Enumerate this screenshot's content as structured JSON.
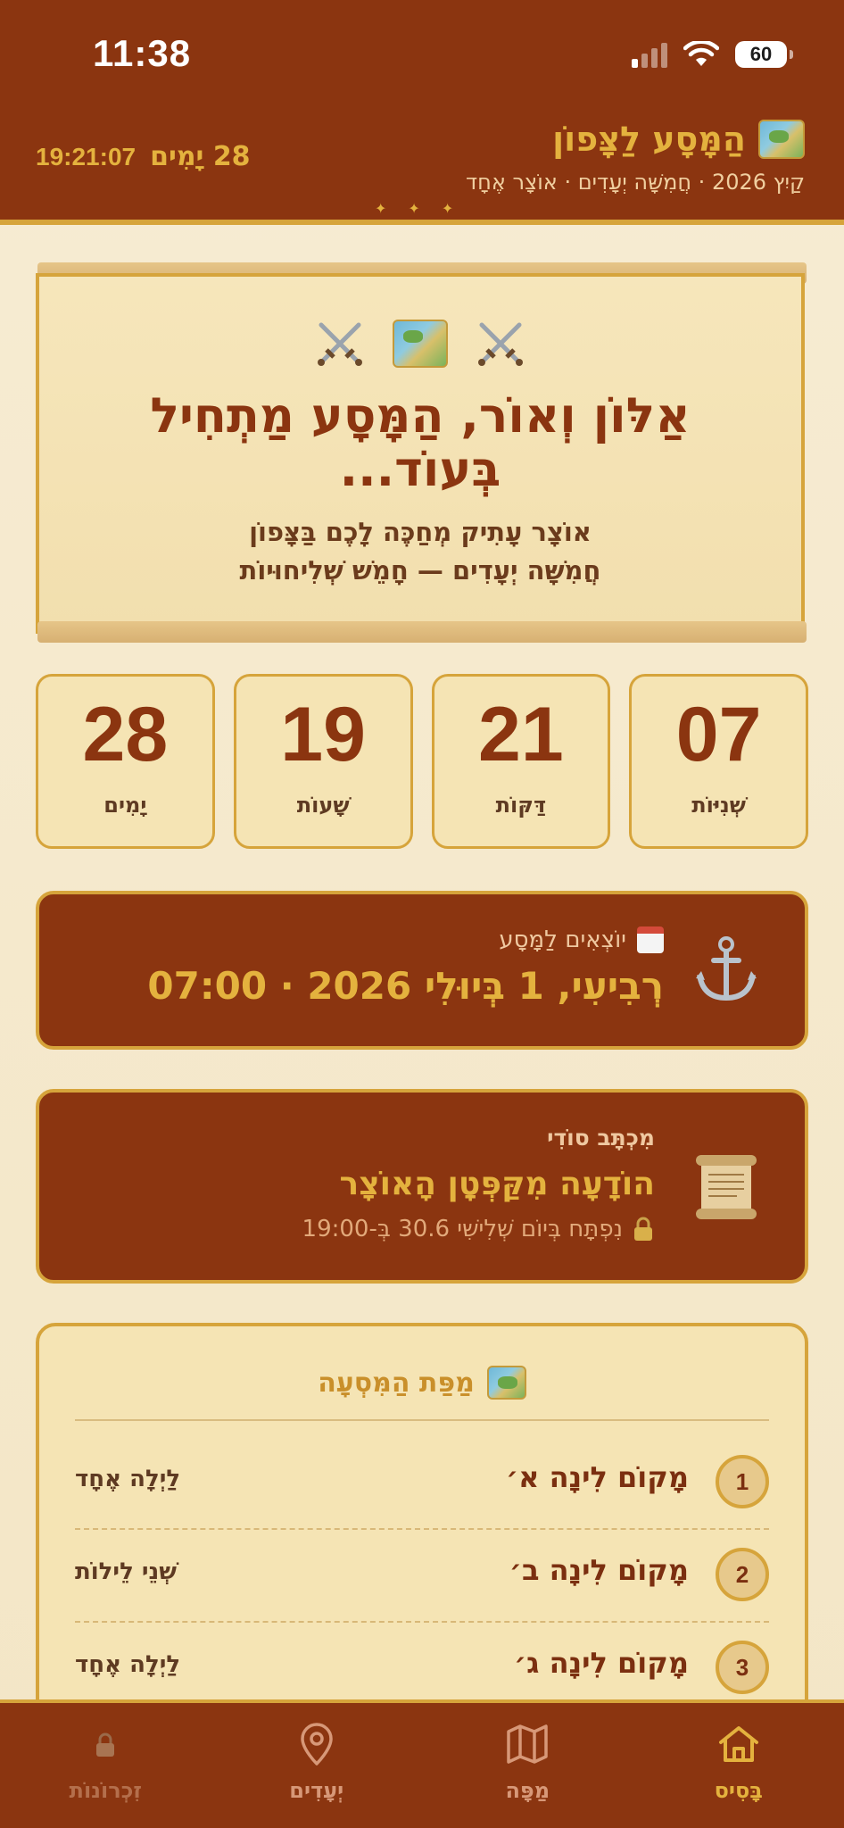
{
  "status_bar": {
    "time": "11:38",
    "battery": "60"
  },
  "header": {
    "title": "הַמָּסָע לַצָּפוֹן",
    "subtitle": "קַיִץ 2026 · חֲמִשָּׁה יְעָדִים · אוֹצָר אֶחָד",
    "countdown_days": "28 יָמִים",
    "countdown_clock": "19:21:07"
  },
  "hero": {
    "title": "אַלּוֹן וְאוֹר, הַמָּסָע מַתְחִיל בְּעוֹד...",
    "subtitle_line1": "אוֹצָר עָתִיק מְחַכֶּה לָכֶם בַּצָּפוֹן",
    "subtitle_line2": "חֲמִשָּׁה יְעָדִים — חָמֵשׁ שְׁלִיחוּיוֹת"
  },
  "countdown": [
    {
      "value": "07",
      "label": "שְׁנִיּוֹת"
    },
    {
      "value": "21",
      "label": "דַּקּוֹת"
    },
    {
      "value": "19",
      "label": "שָׁעוֹת"
    },
    {
      "value": "28",
      "label": "יָמִים"
    }
  ],
  "departure": {
    "label": "יוֹצְאִים לַמָּסָע",
    "date": "רְבִיעִי, 1 בְּיוּלִי 2026 · 07:00"
  },
  "secret_letter": {
    "label": "מִכְתָּב סוֹדִי",
    "title": "הוֹדָעָה מִקַּפְּטָן הָאוֹצָר",
    "lock_text": "נִפְתָּח בְּיוֹם שְׁלִישִׁי 30.6 בְּ-19:00"
  },
  "trip_map": {
    "title": "מַפַּת הַמִּסְעָה",
    "stops": [
      {
        "number": "1",
        "name": "מָקוֹם לִינָה א׳",
        "nights": "לַיְלָה אֶחָד"
      },
      {
        "number": "2",
        "name": "מָקוֹם לִינָה ב׳",
        "nights": "שְׁנֵי לֵילוֹת"
      },
      {
        "number": "3",
        "name": "מָקוֹם לִינָה ג׳",
        "nights": "לַיְלָה אֶחָד"
      }
    ]
  },
  "tabs": [
    {
      "label": "בָּסִיס",
      "icon": "home-icon",
      "state": "active"
    },
    {
      "label": "מַפָּה",
      "icon": "map-icon",
      "state": "normal"
    },
    {
      "label": "יְעָדִים",
      "icon": "location-pin-icon",
      "state": "normal"
    },
    {
      "label": "זִכְרוֹנוֹת",
      "icon": "lock-icon",
      "state": "locked"
    }
  ],
  "colors": {
    "primary": "#8b3510",
    "accent_gold": "#e4b23e",
    "border_gold": "#d6a43b",
    "parchment": "#f5e4b4"
  }
}
